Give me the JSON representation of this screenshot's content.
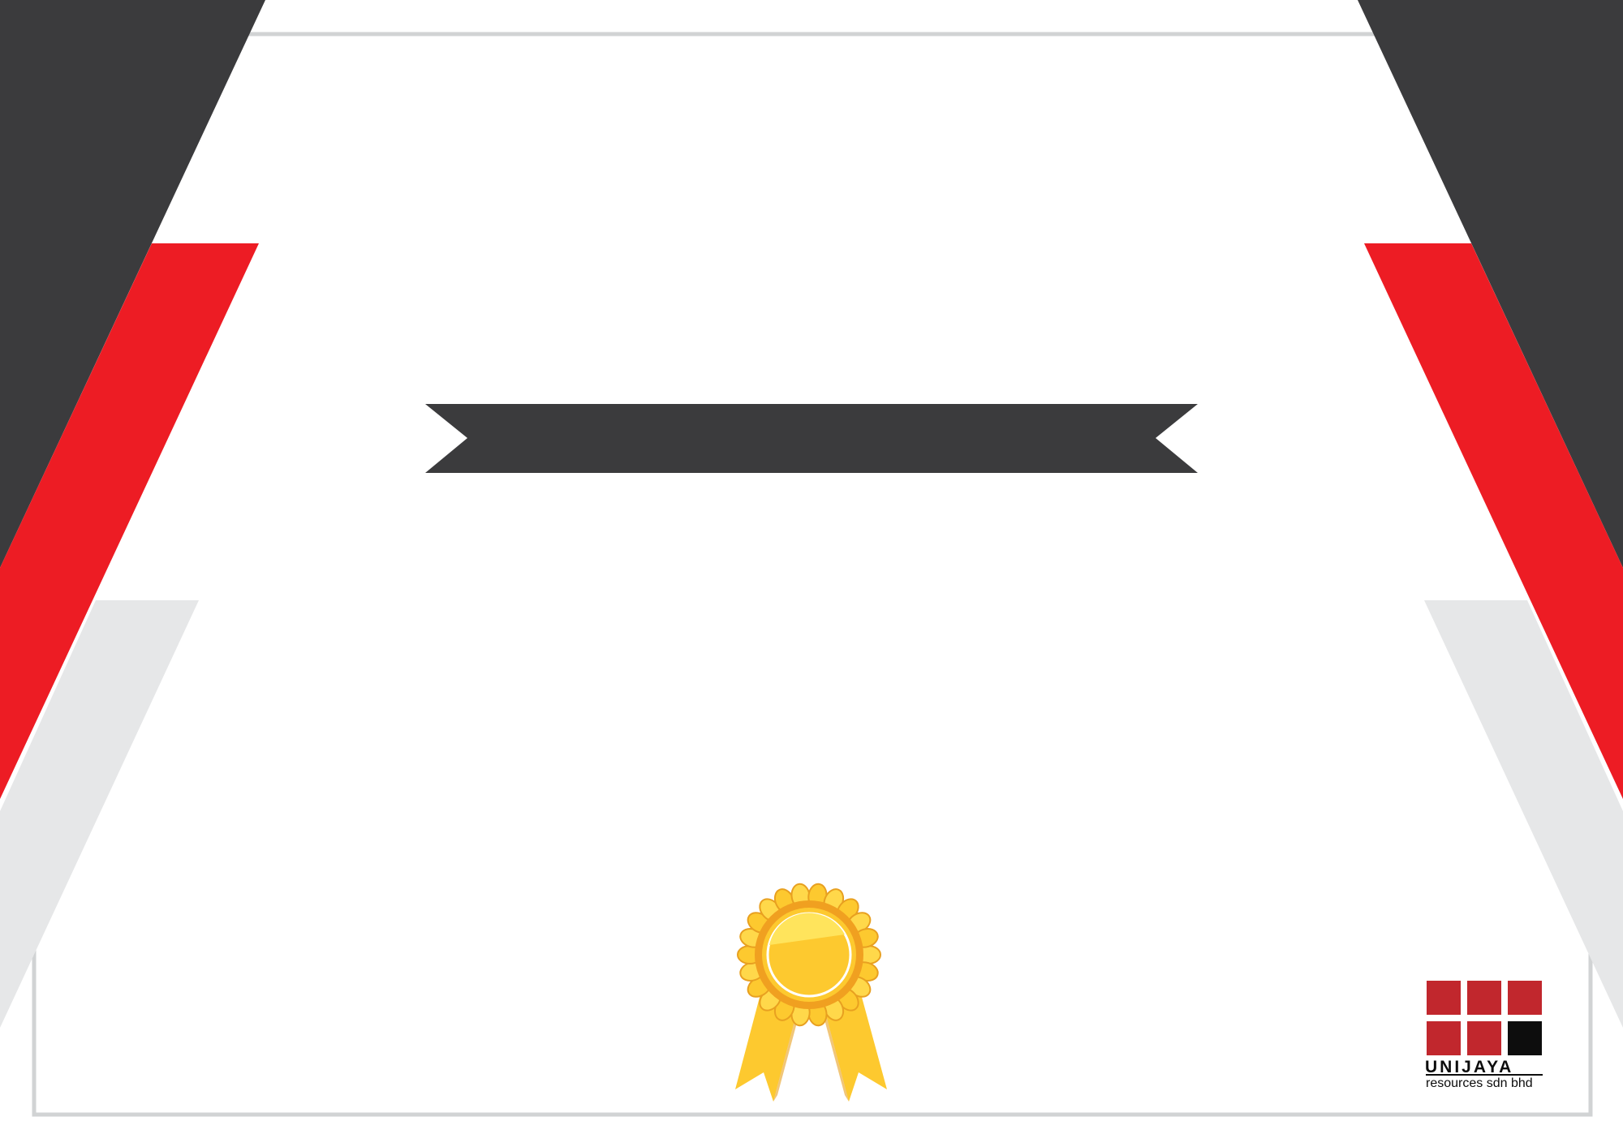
{
  "certificate": {
    "colors": {
      "dark": "#3b3b3d",
      "red": "#ed1c24",
      "light_gray": "#e6e7e8",
      "frame_gray": "#d1d3d4",
      "logo_red": "#c1272d",
      "logo_black": "#0d0d0d",
      "gold": "#fdc92f",
      "gold_dark": "#e8a020",
      "gold_light": "#ffe45c"
    },
    "title_banner": {
      "text": ""
    },
    "award_icon": "rosette-ribbon-icon",
    "logo": {
      "name": "UNIJAYA",
      "subtitle": "resources sdn bhd"
    }
  }
}
